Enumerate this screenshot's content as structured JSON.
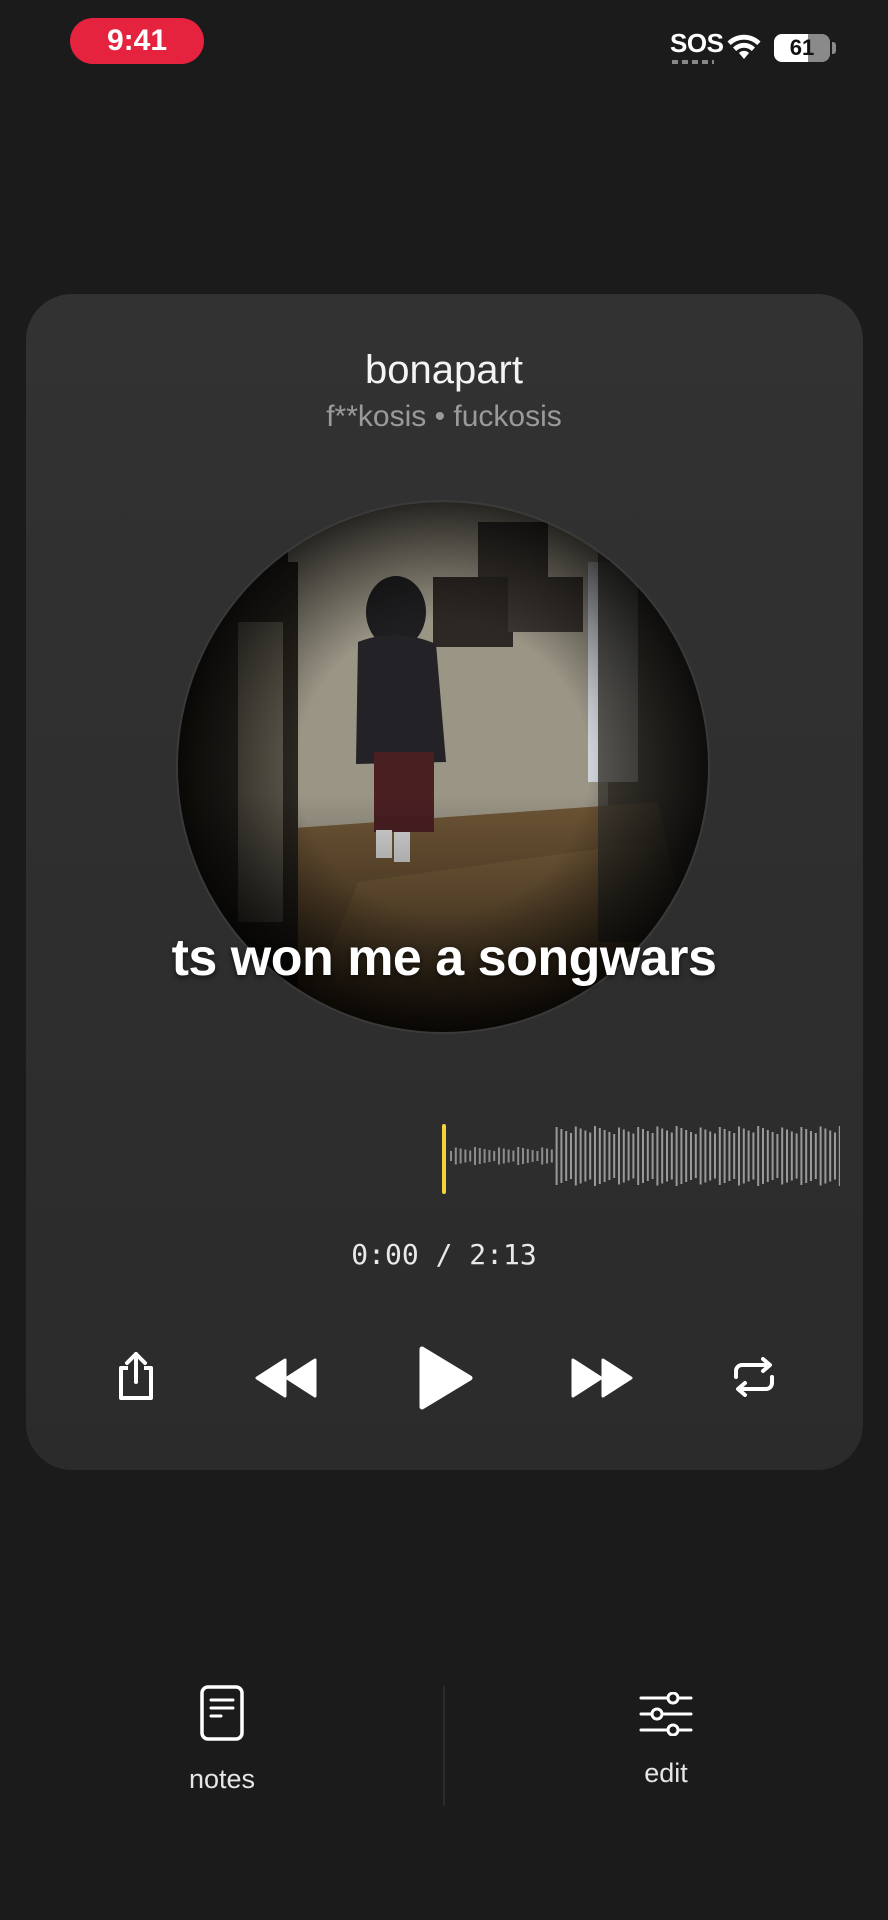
{
  "status_bar": {
    "time": "9:41",
    "sos": "SOS",
    "battery": "61",
    "battery_level": 0.61,
    "accent": "#e5233f"
  },
  "player": {
    "title": "bonapart",
    "subtitle": "f**kosis • fuckosis",
    "lyric_caption": "ts won me a songwars",
    "time_readout": "0:00 / 2:13",
    "progress": 0,
    "playhead_color": "#f2d43a",
    "controls": {
      "share_icon": "share-icon",
      "rewind_icon": "rewind-icon",
      "play_icon": "play-icon",
      "forward_icon": "fast-forward-icon",
      "repeat_icon": "repeat-icon"
    }
  },
  "bottom_bar": {
    "notes_label": "notes",
    "notes_icon": "document-icon",
    "edit_label": "edit",
    "edit_icon": "sliders-icon"
  }
}
